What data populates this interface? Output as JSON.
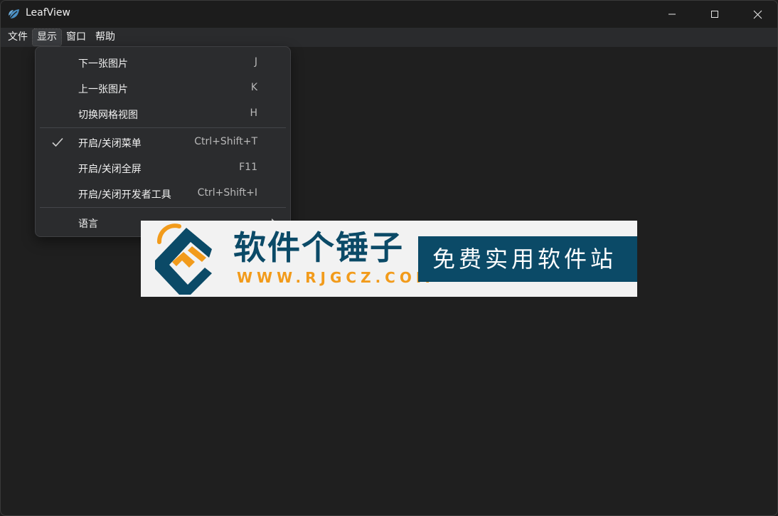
{
  "window": {
    "title": "LeafView"
  },
  "menubar": {
    "items": [
      {
        "label": "文件"
      },
      {
        "label": "显示"
      },
      {
        "label": "窗口"
      },
      {
        "label": "帮助"
      }
    ]
  },
  "dropdown": {
    "items": [
      {
        "label": "下一张图片",
        "shortcut": "J"
      },
      {
        "label": "上一张图片",
        "shortcut": "K"
      },
      {
        "label": "切换网格视图",
        "shortcut": "H"
      },
      {
        "label": "开启/关闭菜单",
        "shortcut": "Ctrl+Shift+T",
        "checked": true
      },
      {
        "label": "开启/关闭全屏",
        "shortcut": "F11"
      },
      {
        "label": "开启/关闭开发者工具",
        "shortcut": "Ctrl+Shift+I"
      },
      {
        "label": "语言",
        "submenu": true
      }
    ]
  },
  "watermark": {
    "name": "软件个锤子",
    "url": "WWW.RJGCZ.COM",
    "slogan": "免费实用软件站"
  },
  "colors": {
    "background": "#1f1f1f",
    "menubar": "#2a2b2d",
    "dropdown": "#2b2c2e",
    "brand_blue": "#0b4a67",
    "brand_orange": "#f29b1b"
  },
  "icons": [
    "leaf-app-icon",
    "minimize-icon",
    "maximize-icon",
    "close-icon",
    "checkmark-icon",
    "chevron-right-icon"
  ]
}
